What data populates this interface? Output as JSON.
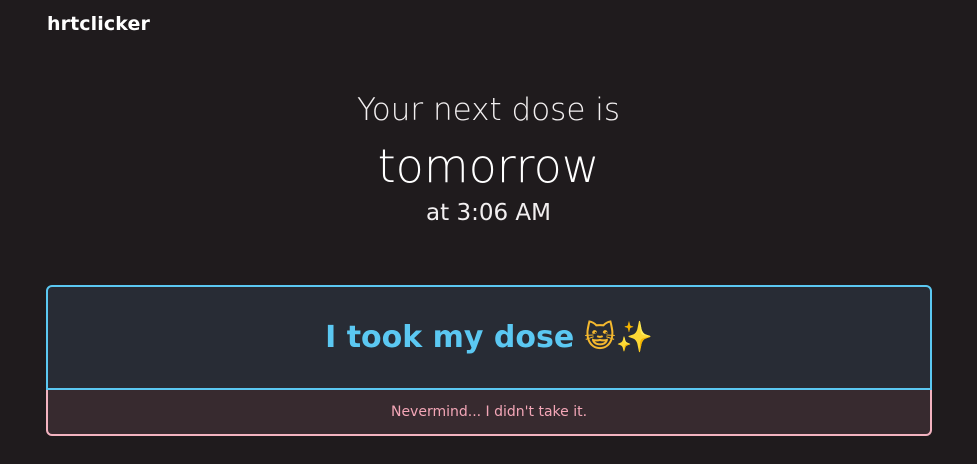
{
  "header": {
    "brand": "hrtclicker"
  },
  "dose": {
    "intro": "Your next dose is",
    "when": "tomorrow",
    "time": "at 3:06 AM"
  },
  "actions": {
    "took_label": "I took my dose",
    "took_emoji": "😺✨",
    "undo_label": "Nevermind... I didn't take it."
  },
  "colors": {
    "background": "#1f1b1d",
    "accent_blue": "#5bc8f2",
    "accent_pink": "#f3b3c0"
  }
}
